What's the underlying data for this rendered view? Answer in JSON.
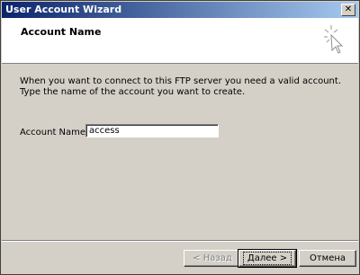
{
  "window": {
    "title": "User Account Wizard"
  },
  "header": {
    "title": "Account Name",
    "icon": "wizard-sparkle-icon"
  },
  "body": {
    "instruction_line1": "When you want to connect to this FTP server you need a valid account.",
    "instruction_line2": "Type the name of the account you want to create.",
    "account_label": "Account Name:",
    "account_value": "access"
  },
  "buttons": {
    "back": "< Назад",
    "next": "Далее >",
    "cancel": "Отмена"
  },
  "colors": {
    "titlebar_start": "#0a246a",
    "titlebar_end": "#a6caf0",
    "face": "#d4d0c8"
  }
}
